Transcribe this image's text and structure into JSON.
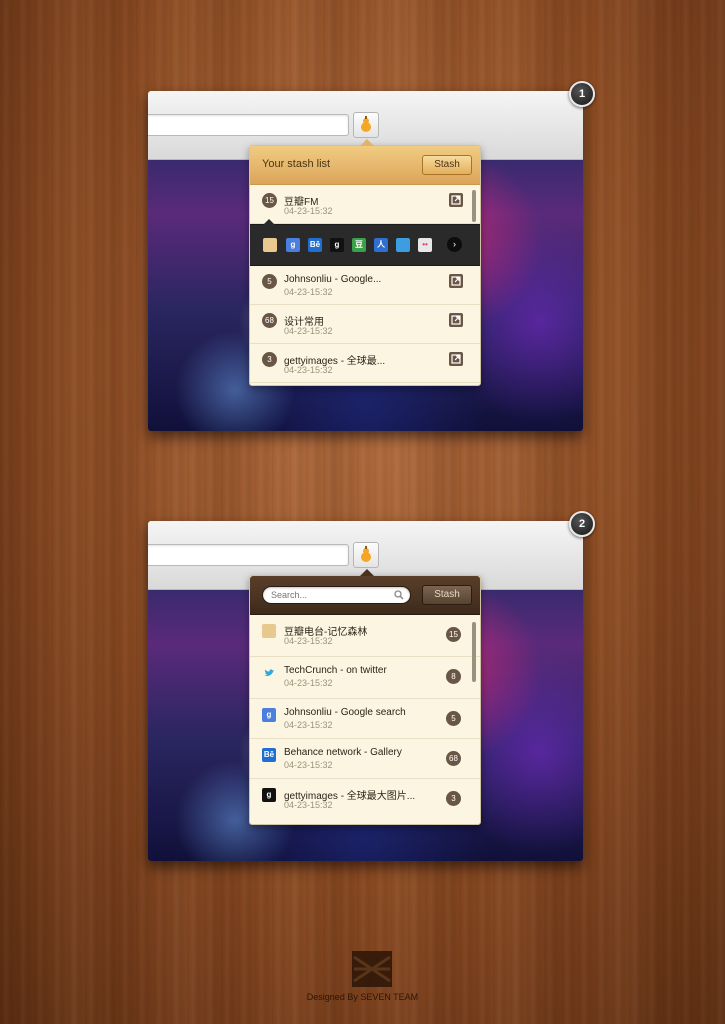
{
  "panel1": {
    "badge": "1",
    "header_title": "Your stash list",
    "stash_label": "Stash",
    "items": [
      {
        "count": "15",
        "name": "豆瓣FM",
        "date": "04-23-15:32"
      },
      {
        "count": "5",
        "name": "Johnsonliu - Google...",
        "date": "04-23-15:32"
      },
      {
        "count": "68",
        "name": "设计常用",
        "date": "04-23-15:32"
      },
      {
        "count": "3",
        "name": "gettyimages - 全球最...",
        "date": "04-23-15:32"
      }
    ],
    "iconbar": [
      {
        "icon": "douban-fm-icon",
        "glyph": "",
        "color": "#e9c98f"
      },
      {
        "icon": "google-icon",
        "glyph": "g",
        "color": "#4a7fe0"
      },
      {
        "icon": "behance-icon",
        "glyph": "Bē",
        "color": "#1f6fd2"
      },
      {
        "icon": "gettyimages-icon",
        "glyph": "g",
        "color": "#111111"
      },
      {
        "icon": "douban-icon",
        "glyph": "豆",
        "color": "#3aa14a"
      },
      {
        "icon": "renren-icon",
        "glyph": "人",
        "color": "#2e6fd0"
      },
      {
        "icon": "qq-icon",
        "glyph": "",
        "color": "#3c9de0"
      },
      {
        "icon": "flickr-icon",
        "glyph": "••",
        "color": "#e7e7e7"
      }
    ],
    "next_glyph": "›"
  },
  "panel2": {
    "badge": "2",
    "search_placeholder": "Search...",
    "stash_label": "Stash",
    "items": [
      {
        "icon": "douban-fm-icon",
        "glyph": "",
        "color": "#e7c88e",
        "name": "豆瓣电台-记忆森林",
        "date": "04-23-15:32",
        "count": "15"
      },
      {
        "icon": "twitter-icon",
        "glyph": "🐦",
        "color": "#fbf5e1",
        "name": "TechCrunch - on twitter",
        "date": "04-23-15:32",
        "count": "8"
      },
      {
        "icon": "google-icon",
        "glyph": "g",
        "color": "#4a7fe0",
        "name": "Johnsonliu - Google search",
        "date": "04-23-15:32",
        "count": "5"
      },
      {
        "icon": "behance-icon",
        "glyph": "Bē",
        "color": "#1f6fd2",
        "name": "Behance network - Gallery",
        "date": "04-23-15:32",
        "count": "68"
      },
      {
        "icon": "gettyimages-icon",
        "glyph": "g",
        "color": "#111111",
        "name": "gettyimages - 全球最大图片...",
        "date": "04-23-15:32",
        "count": "3"
      }
    ]
  },
  "footer": {
    "credit": "Designed By SEVEN TEAM"
  }
}
